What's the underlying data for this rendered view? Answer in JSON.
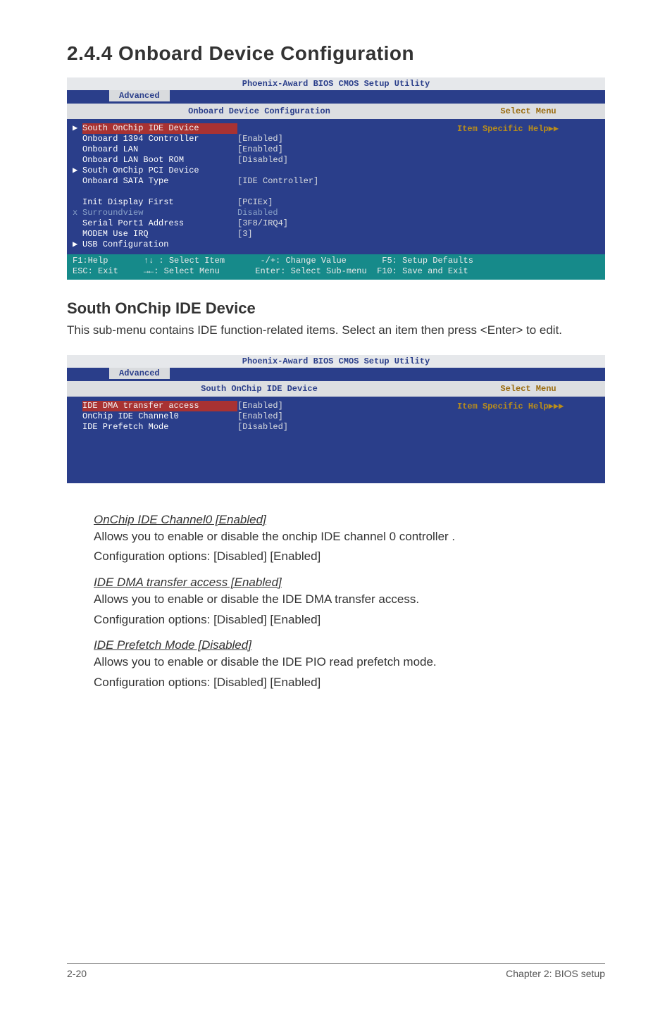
{
  "section": {
    "title": "2.4.4   Onboard Device Configuration"
  },
  "bios1": {
    "top": "Phoenix-Award BIOS CMOS Setup Utility",
    "tab": "Advanced",
    "left_header": "Onboard Device Configuration",
    "right_header": "Select Menu",
    "help_label": "Item Specific Help",
    "lines": [
      {
        "mark": "▶",
        "label": "South OnChip IDE Device",
        "value": "",
        "selected": true
      },
      {
        "mark": " ",
        "label": "Onboard 1394 Controller",
        "value": "[Enabled]"
      },
      {
        "mark": " ",
        "label": "Onboard LAN",
        "value": "[Enabled]"
      },
      {
        "mark": " ",
        "label": "Onboard LAN Boot ROM",
        "value": "[Disabled]"
      },
      {
        "mark": "▶",
        "label": "South OnChip PCI Device",
        "value": ""
      },
      {
        "mark": " ",
        "label": "Onboard SATA Type",
        "value": "[IDE Controller]"
      },
      {
        "mark": " ",
        "label": "",
        "value": ""
      },
      {
        "mark": " ",
        "label": "Init Display First",
        "value": "[PCIEx]"
      },
      {
        "mark": "x",
        "label": "Surroundview",
        "value": "Disabled",
        "gray": true
      },
      {
        "mark": " ",
        "label": "Serial Port1 Address",
        "value": "[3F8/IRQ4]"
      },
      {
        "mark": " ",
        "label": "MODEM Use IRQ",
        "value": "[3]"
      },
      {
        "mark": "▶",
        "label": "USB Configuration",
        "value": ""
      }
    ],
    "footer_l1": "F1:Help       ↑↓ : Select Item       -/+: Change Value       F5: Setup Defaults",
    "footer_l2": "ESC: Exit     →←: Select Menu       Enter: Select Sub-menu  F10: Save and Exit"
  },
  "south_section": {
    "title": "South OnChip IDE Device",
    "desc": "This sub-menu contains IDE function-related items. Select an item then press <Enter> to edit."
  },
  "bios2": {
    "top": "Phoenix-Award BIOS CMOS Setup Utility",
    "tab": "Advanced",
    "left_header": "South OnChip IDE Device",
    "right_header": "Select Menu",
    "help_label": "Item Specific Help",
    "lines": [
      {
        "mark": " ",
        "label": "IDE DMA transfer access",
        "value": "[Enabled]",
        "selected": true
      },
      {
        "mark": " ",
        "label": "OnChip IDE Channel0",
        "value": "[Enabled]"
      },
      {
        "mark": " ",
        "label": "IDE Prefetch Mode",
        "value": "[Disabled]"
      }
    ]
  },
  "items": {
    "a_title": "OnChip IDE Channel0 [Enabled]",
    "a_l1": "Allows you to enable or disable the onchip IDE channel 0 controller .",
    "a_l2": "Configuration options: [Disabled] [Enabled]",
    "b_title": "IDE DMA transfer access [Enabled]",
    "b_l1": "Allows you to enable or disable the IDE DMA transfer access.",
    "b_l2": "Configuration options: [Disabled] [Enabled]",
    "c_title": "IDE Prefetch Mode [Disabled]",
    "c_l1": "Allows you to enable or disable the IDE PIO read prefetch mode.",
    "c_l2": "Configuration options: [Disabled] [Enabled]"
  },
  "footer": {
    "left": "2-20",
    "right": "Chapter 2: BIOS setup"
  }
}
